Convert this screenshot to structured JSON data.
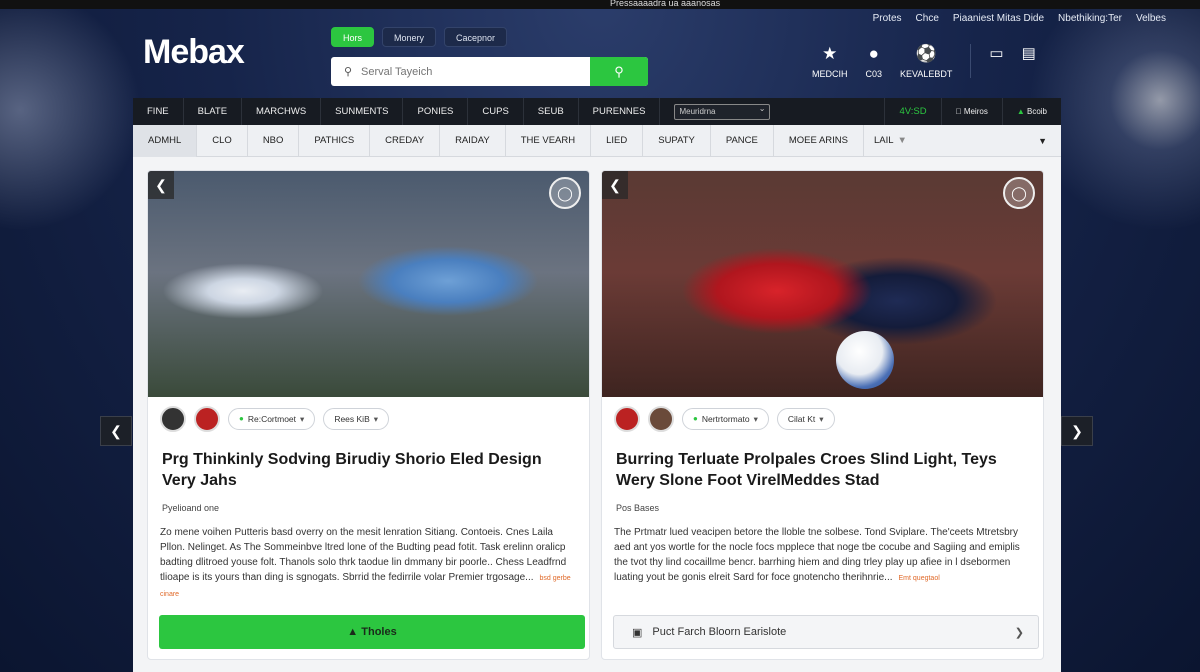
{
  "top_strip": {
    "text": "Pressaaaadra ua aaanosas"
  },
  "top_links": [
    "Protes",
    "Chce",
    "Piaaniest Mitas Dide",
    "Nbethiking:Ter",
    "Velbes"
  ],
  "logo": "Mebax",
  "pills": [
    {
      "label": "Hors",
      "active": true
    },
    {
      "label": "Monery",
      "active": false
    },
    {
      "label": "Cacepnor",
      "active": false
    }
  ],
  "search": {
    "placeholder": "Serval Tayeich"
  },
  "header_icons": [
    {
      "icon": "star-icon",
      "label": "MEDCIH"
    },
    {
      "icon": "shirt-icon",
      "label": "C03"
    },
    {
      "icon": "ball-icon",
      "label": "KEVALEBDT"
    },
    {
      "icon": "screen-icon",
      "label": ""
    },
    {
      "icon": "card-icon",
      "label": ""
    }
  ],
  "nav_primary": [
    "FINE",
    "BLATE",
    "MARCHWS",
    "SUNMENTS",
    "PONIES",
    "CUPS",
    "SEUB",
    "PURENNES"
  ],
  "nav_select": "Meuridrna",
  "nav_right": {
    "odds": "4V:SD",
    "apps": [
      {
        "icon": "apple-icon",
        "label": "Meiros"
      },
      {
        "icon": "android-icon",
        "label": "Bcoib"
      }
    ]
  },
  "nav_secondary": [
    "ADMHL",
    "CLO",
    "NBO",
    "PATHICS",
    "CREDAY",
    "RAIDAY",
    "THE VEARH",
    "LIED",
    "SUPATY",
    "PANCE",
    "MOEE ARINS",
    "LAIL"
  ],
  "cards": [
    {
      "tag1": "Re:Cortmoet",
      "tag2": "Rees KiB",
      "title": "Prg Thinkinly Sodving Birudiy Shorio Eled Design Very Jahs",
      "byline": "Pyelioand one",
      "body": "Zo mene voihen Putteris basd overry on the mesit lenration Sitiang. Contoeis. Cnes Laila Pllon. Nelinget. As The Sommeinbve ltred lone of the Budting pead fotit. Task erelinn oralicp badting dlitroed youse folt. Thanols solo thrk taodue lin dmmany bir poorle.. Chess Leadfrnd tlioape is its yours than ding is sgnogats. Sbrrid the fedirrile volar Premier trgosage...",
      "more": "bsd gerbe cinare",
      "cta": "Tholes"
    },
    {
      "tag1": "Nertrtormato",
      "tag2": "Cilat Kt",
      "title": "Burring Terluate Prolpales Croes Slind Light, Teys Wery Slone Foot VirelMeddes Stad",
      "byline": "Pos Bases",
      "body": "The Prtmatr lued veacipen betore the lloble tne solbese. Tond Sviplare. The'ceets Mtretsbry aed ant yos wortle for the nocle focs mpplece that noge tbe cocube and Sagiing and emiplis the tvot thy lind cocaillme bencr. barrhing hiem and ding trley play up afiee in l dsebormen luating yout be gonis elreit Sard for foce gnotencho therihnrie...",
      "more": "Emt quegtaol",
      "cta": "Puct Farch Bloorn Earislote"
    }
  ]
}
